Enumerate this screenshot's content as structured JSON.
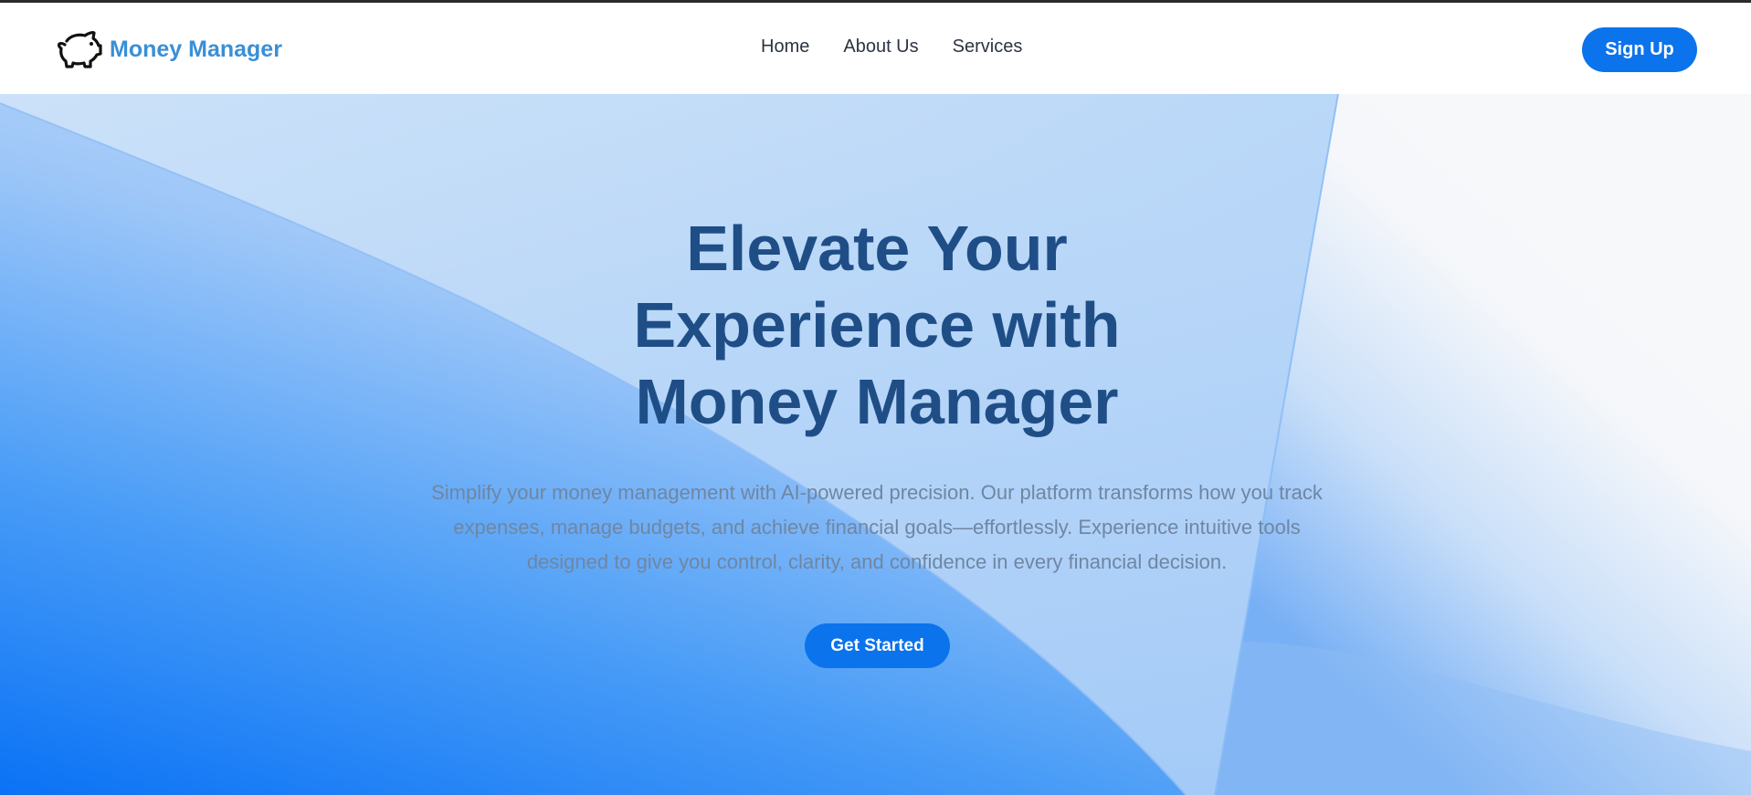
{
  "brand": {
    "name": "Money Manager",
    "icon": "piggy-bank-icon"
  },
  "nav": {
    "links": [
      {
        "label": "Home"
      },
      {
        "label": "About Us"
      },
      {
        "label": "Services"
      }
    ]
  },
  "header": {
    "signup_label": "Sign Up"
  },
  "hero": {
    "title_lines": [
      "Elevate Your",
      "Experience with",
      "Money Manager"
    ],
    "description": "Simplify your money management with AI-powered precision. Our platform transforms how you track expenses, manage budgets, and achieve financial goals—effortlessly. Experience intuitive tools designed to give you control, clarity, and confidence in every financial decision.",
    "cta_label": "Get Started"
  },
  "colors": {
    "accent": "#0b73ec",
    "brand_text": "#3a8fd6",
    "hero_title": "#1f4e87",
    "hero_text": "#6f86a3"
  }
}
